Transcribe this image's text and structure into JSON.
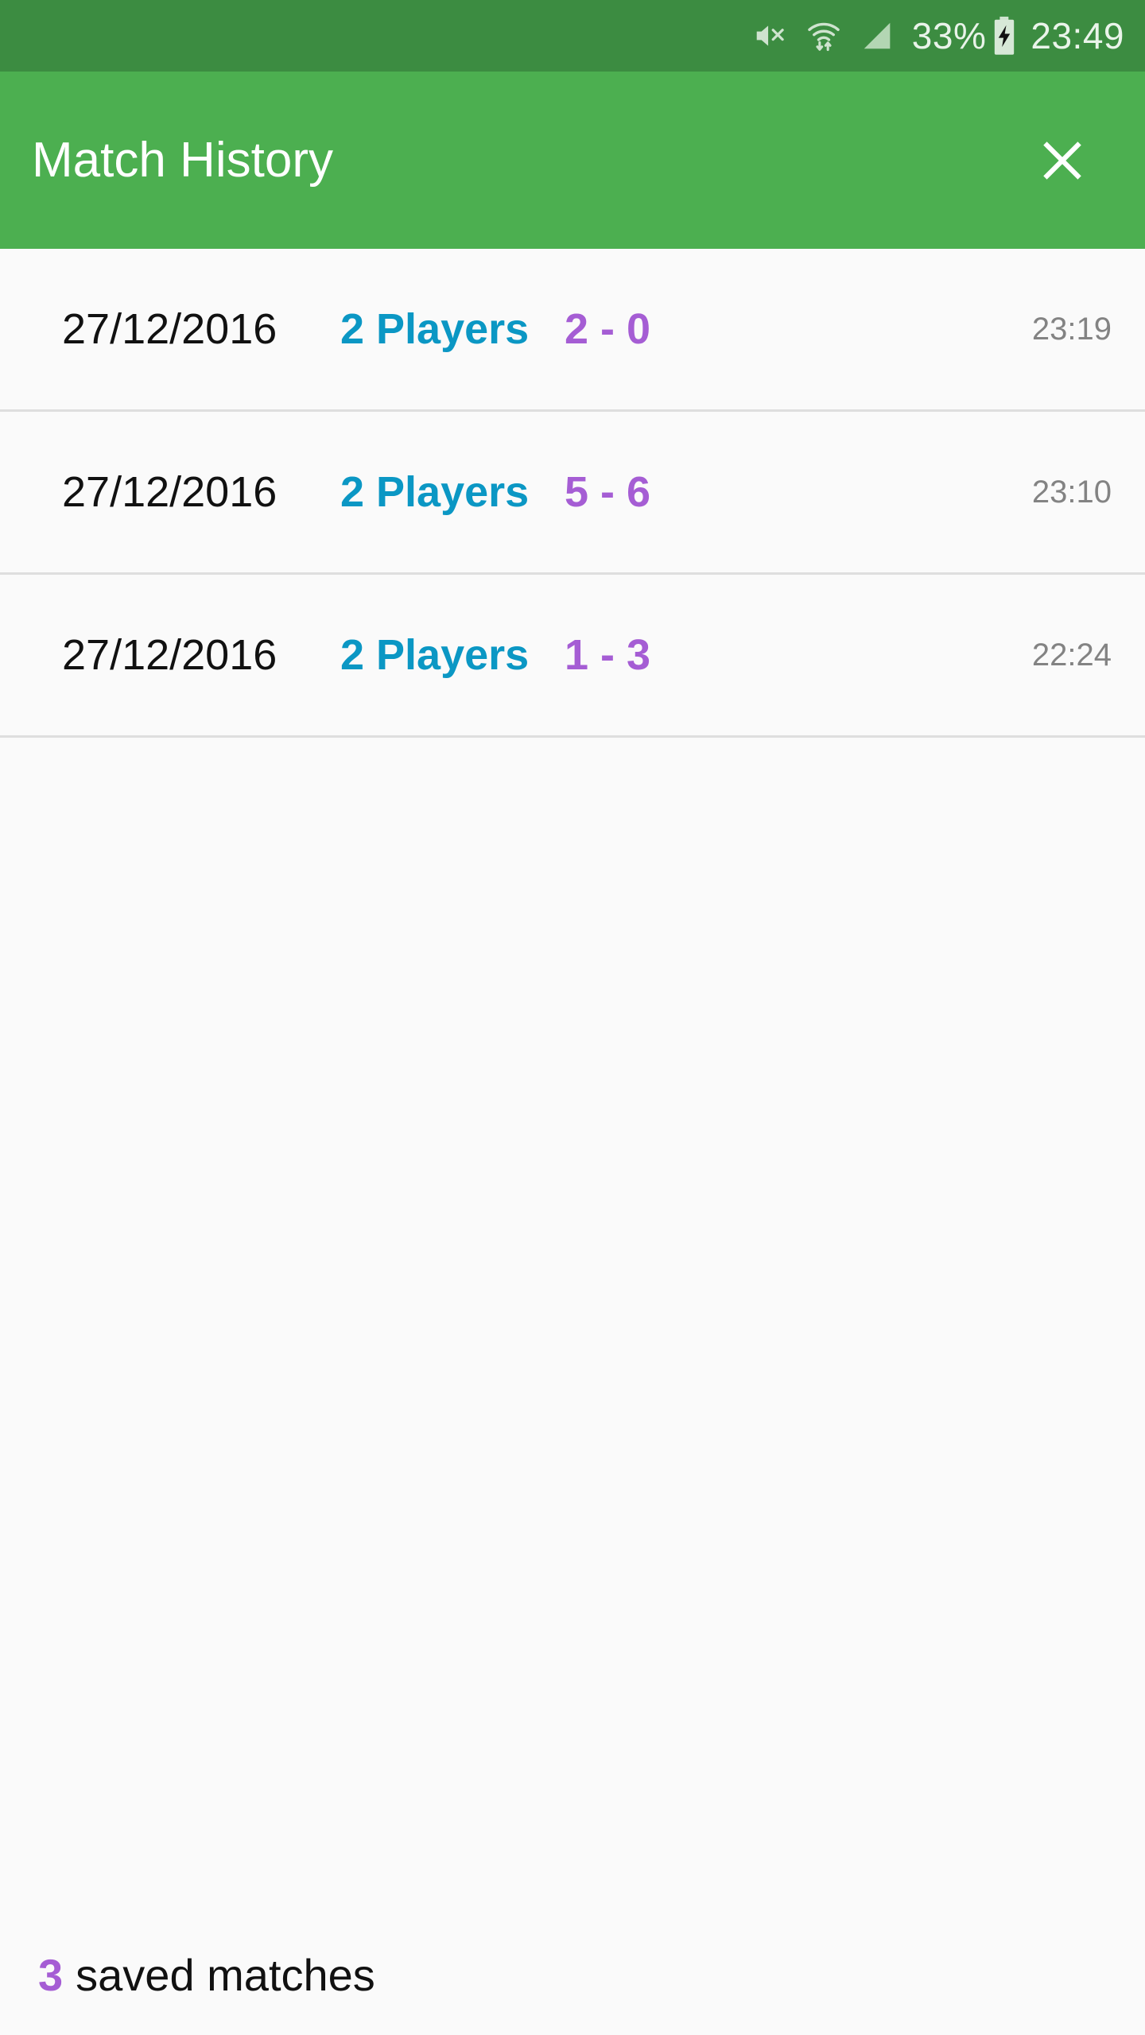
{
  "status_bar": {
    "background_color": "#3C8C41",
    "mute_icon": "volume-mute-icon",
    "wifi_icon": "wifi-data-transfer-icon",
    "signal_icon": "cellular-signal-icon",
    "battery_percent": "33%",
    "battery_icon": "battery-charging-icon",
    "clock": "23:49"
  },
  "app_bar": {
    "title": "Match History",
    "background_color": "#4CAF50",
    "close_icon": "close-icon"
  },
  "colors": {
    "players_blue": "#0B97C4",
    "score_purple": "#A55DD4",
    "time_gray": "#838383",
    "divider": "#DEDEDE",
    "content_background": "#FAFAFA"
  },
  "matches": [
    {
      "date": "27/12/2016",
      "players": "2 Players",
      "score": "2 - 0",
      "time": "23:19"
    },
    {
      "date": "27/12/2016",
      "players": "2 Players",
      "score": "5 - 6",
      "time": "23:10"
    },
    {
      "date": "27/12/2016",
      "players": "2 Players",
      "score": "1 - 3",
      "time": "22:24"
    }
  ],
  "footer": {
    "count": "3",
    "label": "saved matches"
  }
}
